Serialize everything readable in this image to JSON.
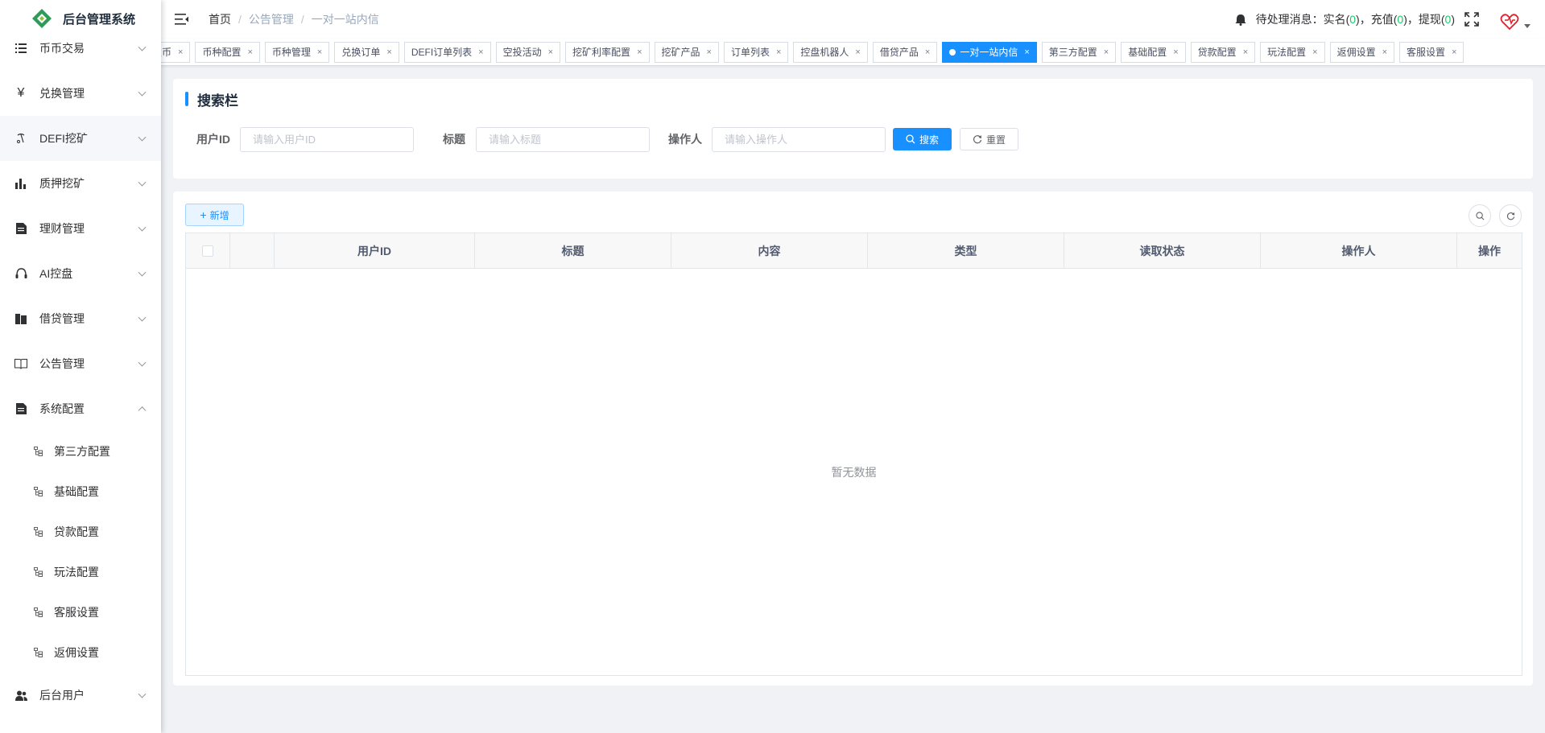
{
  "app": {
    "title": "后台管理系统"
  },
  "sidebar": {
    "items": [
      {
        "label": "币币交易",
        "icon": "list-icon"
      },
      {
        "label": "兑换管理",
        "icon": "yen-icon"
      },
      {
        "label": "DEFI挖矿",
        "icon": "pickaxe-icon"
      },
      {
        "label": "质押挖矿",
        "icon": "bar-chart-icon"
      },
      {
        "label": "理财管理",
        "icon": "document-icon"
      },
      {
        "label": "AI控盘",
        "icon": "robot-icon"
      },
      {
        "label": "借贷管理",
        "icon": "wallet-icon"
      },
      {
        "label": "公告管理",
        "icon": "book-icon"
      },
      {
        "label": "系统配置",
        "icon": "document-icon"
      }
    ],
    "sub_items": [
      {
        "label": "第三方配置"
      },
      {
        "label": "基础配置"
      },
      {
        "label": "贷款配置"
      },
      {
        "label": "玩法配置"
      },
      {
        "label": "客服设置"
      },
      {
        "label": "返佣设置"
      }
    ],
    "last_item": {
      "label": "后台用户",
      "icon": "users-icon"
    }
  },
  "header": {
    "breadcrumb": [
      "首页",
      "公告管理",
      "一对一站内信"
    ],
    "pending_label": "待处理消息：",
    "pending": [
      {
        "label": "实名(",
        "count": "0",
        "close": ")，"
      },
      {
        "label": "充值(",
        "count": "0",
        "close": ")，"
      },
      {
        "label": "提现(",
        "count": "0",
        "close": ")"
      }
    ]
  },
  "tags": [
    {
      "label": "发币"
    },
    {
      "label": "币种配置"
    },
    {
      "label": "币种管理"
    },
    {
      "label": "兑换订单"
    },
    {
      "label": "DEFI订单列表"
    },
    {
      "label": "空投活动"
    },
    {
      "label": "挖矿利率配置"
    },
    {
      "label": "挖矿产品"
    },
    {
      "label": "订单列表"
    },
    {
      "label": "控盘机器人"
    },
    {
      "label": "借贷产品"
    },
    {
      "label": "一对一站内信",
      "active": true
    },
    {
      "label": "第三方配置"
    },
    {
      "label": "基础配置"
    },
    {
      "label": "贷款配置"
    },
    {
      "label": "玩法配置"
    },
    {
      "label": "返佣设置"
    },
    {
      "label": "客服设置"
    }
  ],
  "search": {
    "title": "搜索栏",
    "fields": [
      {
        "label": "用户ID",
        "placeholder": "请输入用户ID",
        "value": ""
      },
      {
        "label": "标题",
        "placeholder": "请输入标题",
        "value": ""
      },
      {
        "label": "操作人",
        "placeholder": "请输入操作人",
        "value": ""
      }
    ],
    "search_label": "搜索",
    "reset_label": "重置"
  },
  "table": {
    "add_label": "新增",
    "columns": [
      "",
      "",
      "用户ID",
      "标题",
      "内容",
      "类型",
      "读取状态",
      "操作人",
      "操作"
    ],
    "rows": [],
    "empty_text": "暂无数据"
  },
  "colors": {
    "primary": "#1890ff",
    "count": "#13ce66",
    "avatar": "#e0202a"
  }
}
